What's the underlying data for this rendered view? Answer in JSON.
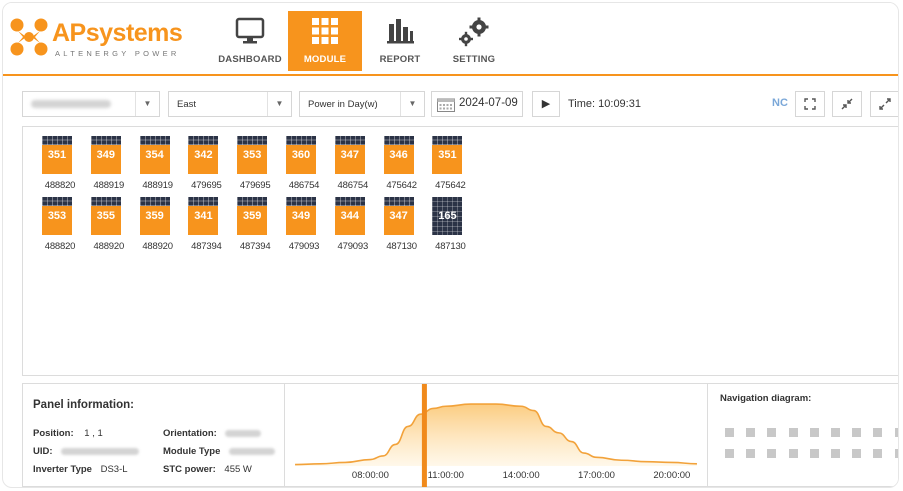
{
  "brand": {
    "name_ap": "AP",
    "name_systems": "systems",
    "tagline": "ALTENERGY POWER",
    "colors": {
      "accent": "#f7941d",
      "panel_dark": "#2b3346",
      "nc": "#7aa7d8"
    }
  },
  "nav": {
    "items": [
      {
        "label": "DASHBOARD",
        "icon": "monitor-icon",
        "active": false
      },
      {
        "label": "MODULE",
        "icon": "grid-icon",
        "active": true
      },
      {
        "label": "REPORT",
        "icon": "bar-chart-icon",
        "active": false
      },
      {
        "label": "SETTING",
        "icon": "gears-icon",
        "active": false
      }
    ]
  },
  "toolbar": {
    "orientation_select": "East",
    "metric_select": "Power in Day(w)",
    "date": "2024-07-09",
    "play_icon": "▶",
    "time_label": "Time: 10:09:31",
    "nc_label": "NC",
    "btn_fit_icon": "⛶",
    "btn_shrink_icon": "⤡",
    "btn_expand_icon": "⤢"
  },
  "modules": {
    "row1": [
      {
        "value": "351",
        "uid": "488820"
      },
      {
        "value": "349",
        "uid": "488919"
      },
      {
        "value": "354",
        "uid": "488919"
      },
      {
        "value": "342",
        "uid": "479695"
      },
      {
        "value": "353",
        "uid": "479695"
      },
      {
        "value": "360",
        "uid": "486754"
      },
      {
        "value": "347",
        "uid": "486754"
      },
      {
        "value": "346",
        "uid": "475642"
      },
      {
        "value": "351",
        "uid": "475642"
      }
    ],
    "row2": [
      {
        "value": "353",
        "uid": "488820"
      },
      {
        "value": "355",
        "uid": "488920"
      },
      {
        "value": "359",
        "uid": "488920"
      },
      {
        "value": "341",
        "uid": "487394"
      },
      {
        "value": "359",
        "uid": "487394"
      },
      {
        "value": "349",
        "uid": "479093"
      },
      {
        "value": "344",
        "uid": "479093"
      },
      {
        "value": "347",
        "uid": "487130"
      },
      {
        "value": "165",
        "uid": "487130",
        "dark": true
      }
    ]
  },
  "panel_info": {
    "title": "Panel information:",
    "position_label": "Position:",
    "position_value": "1 , 1",
    "uid_label": "UID:",
    "inverter_label": "Inverter Type",
    "inverter_value": "DS3-L",
    "orientation_label": "Orientation:",
    "module_type_label": "Module Type",
    "stc_label": "STC power:",
    "stc_value": "455 W"
  },
  "chart_data": {
    "type": "area",
    "x_ticks": [
      "08:00:00",
      "11:00:00",
      "14:00:00",
      "17:00:00",
      "20:00:00"
    ],
    "x_hours": [
      5.0,
      6.0,
      7.0,
      8.0,
      8.5,
      9.0,
      9.5,
      10.0,
      10.5,
      11.0,
      12.0,
      13.0,
      14.0,
      14.5,
      15.0,
      15.5,
      16.0,
      16.5,
      17.0,
      18.0,
      19.0,
      20.0,
      21.0
    ],
    "values": [
      2,
      3,
      5,
      9,
      14,
      30,
      55,
      72,
      80,
      83,
      86,
      86,
      83,
      77,
      55,
      46,
      34,
      18,
      12,
      8,
      6,
      5,
      3
    ],
    "cursor_hour": 10.15,
    "xlim": [
      4.6,
      21.4
    ],
    "ylim": [
      0,
      100
    ]
  },
  "navigation": {
    "title": "Navigation diagram:",
    "rows": 2,
    "cols": 9
  }
}
